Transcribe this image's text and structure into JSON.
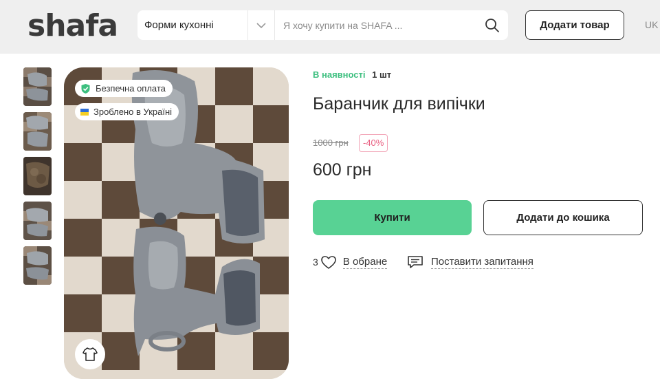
{
  "header": {
    "logo": "shafa",
    "category": "Форми кухонні",
    "search_placeholder": "Я хочу купити на SHAFA ...",
    "add_item_label": "Додати товар",
    "language": "UK"
  },
  "gallery": {
    "thumbnail_count": 5,
    "badges": {
      "secure_payment": "Безпечна оплата",
      "made_in_ukraine": "Зроблено в Україні"
    }
  },
  "product": {
    "availability": "В наявності",
    "quantity": "1 шт",
    "title": "Баранчик для випічки",
    "old_price": "1000 грн",
    "discount": "-40%",
    "price": "600 грн",
    "buy_label": "Купити",
    "cart_label": "Додати до кошика",
    "favorites_count": "3",
    "favorites_label": "В обране",
    "question_label": "Поставити запитання"
  },
  "colors": {
    "accent_green": "#58d294",
    "availability_green": "#3dbf7f",
    "discount_pink": "#e85d7f",
    "header_bg": "#efefef"
  }
}
